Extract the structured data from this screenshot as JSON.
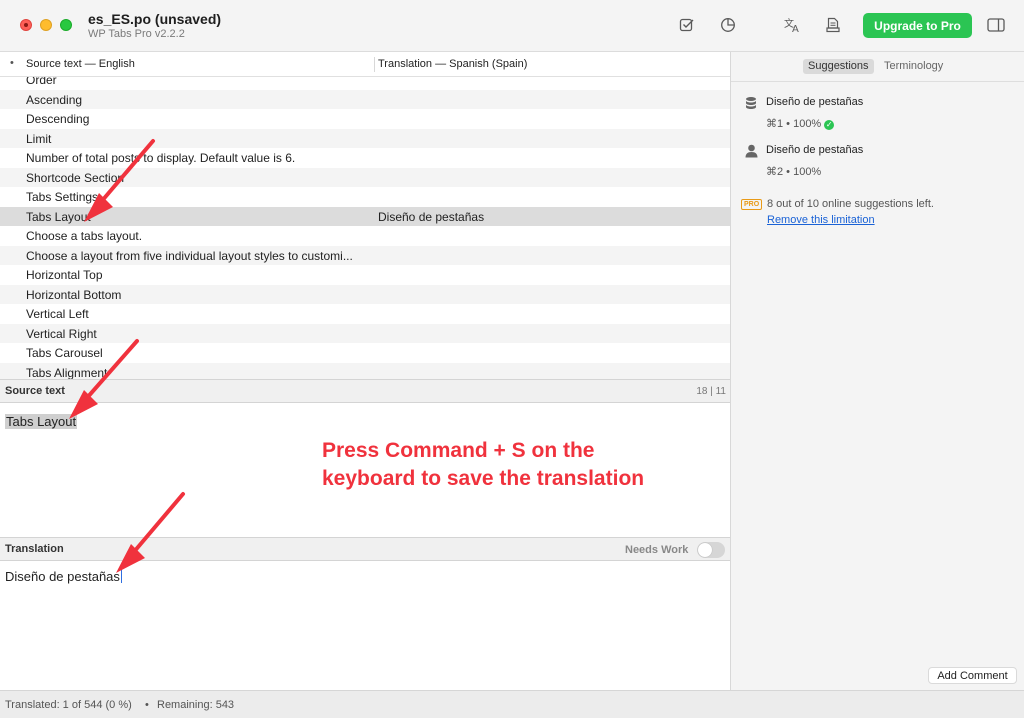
{
  "window": {
    "title": "es_ES.po (unsaved)",
    "subtitle": "WP Tabs Pro v2.2.2"
  },
  "toolbar": {
    "upgrade_label": "Upgrade to Pro",
    "icons": [
      "checkbox-icon",
      "pie-chart-icon",
      "translate-icon",
      "document-icon",
      "sidebar-icon"
    ]
  },
  "table": {
    "dot": "•",
    "col_source": "Source text — English",
    "col_translation": "Translation — Spanish (Spain)",
    "rows": [
      {
        "source": "Order",
        "translation": ""
      },
      {
        "source": "Ascending",
        "translation": ""
      },
      {
        "source": "Descending",
        "translation": ""
      },
      {
        "source": "Limit",
        "translation": ""
      },
      {
        "source": "Number of total posts to display. Default value is 6.",
        "translation": ""
      },
      {
        "source": "Shortcode Section",
        "translation": ""
      },
      {
        "source": "Tabs Settings",
        "translation": ""
      },
      {
        "source": "Tabs Layout",
        "translation": "Diseño de pestañas"
      },
      {
        "source": "Choose a tabs layout.",
        "translation": ""
      },
      {
        "source": "Choose a layout from five individual layout styles to customi...",
        "translation": ""
      },
      {
        "source": "Horizontal Top",
        "translation": ""
      },
      {
        "source": "Horizontal Bottom",
        "translation": ""
      },
      {
        "source": "Vertical Left",
        "translation": ""
      },
      {
        "source": "Vertical Right",
        "translation": ""
      },
      {
        "source": "Tabs Carousel",
        "translation": ""
      },
      {
        "source": "Tabs Alignment",
        "translation": ""
      }
    ],
    "selected_index": 7
  },
  "source_section": {
    "label": "Source text",
    "counter": "18 | 11",
    "text": "Tabs Layout"
  },
  "translation_section": {
    "label": "Translation",
    "needs_work_label": "Needs Work",
    "needs_work_on": false,
    "text": "Diseño de pestañas"
  },
  "annotation": {
    "line1": "Press Command + S on the",
    "line2": "keyboard to save the translation",
    "color": "#f0323d"
  },
  "right_panel": {
    "tab_suggestions": "Suggestions",
    "tab_terminology": "Terminology",
    "suggestions": [
      {
        "icon": "database-icon",
        "text": "Diseño de pestañas",
        "meta": "⌘1 • 100%",
        "verified": true
      },
      {
        "icon": "person-icon",
        "text": "Diseño de pestañas",
        "meta": "⌘2 • 100%",
        "verified": false
      }
    ],
    "pro_badge": "PRO",
    "pro_text": "8 out of 10 online suggestions left.",
    "pro_link": "Remove this limitation",
    "add_comment": "Add Comment"
  },
  "status": {
    "translated": "Translated: 1 of 544 (0 %)",
    "separator": "•",
    "remaining": "Remaining: 543"
  },
  "colors": {
    "accent_green": "#2bc553",
    "link_blue": "#1a62d6",
    "annotation_red": "#f0323d",
    "pro_orange": "#e89a17"
  }
}
